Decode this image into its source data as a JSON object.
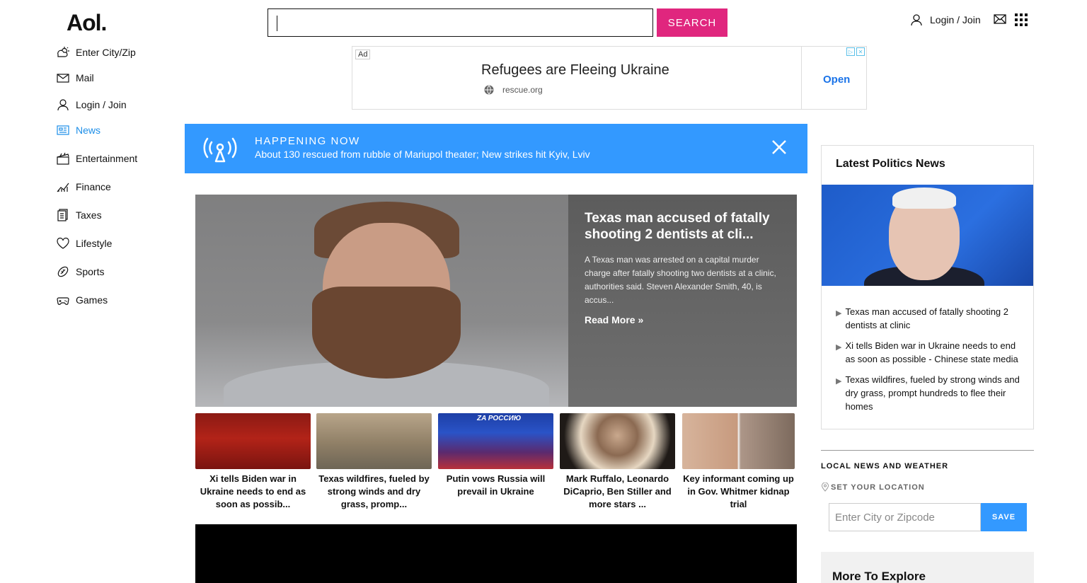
{
  "header": {
    "logo": "Aol.",
    "search_value": "",
    "search_button": "SEARCH",
    "login": "Login / Join"
  },
  "sidebar": {
    "items": [
      {
        "label": "Enter City/Zip",
        "icon": "weather-icon"
      },
      {
        "label": "Mail",
        "icon": "mail-icon"
      },
      {
        "label": "Login / Join",
        "icon": "user-icon"
      },
      {
        "label": "News",
        "icon": "news-icon",
        "active": true
      },
      {
        "label": "Entertainment",
        "icon": "clapperboard-icon"
      },
      {
        "label": "Finance",
        "icon": "chart-icon"
      },
      {
        "label": "Taxes",
        "icon": "document-icon"
      },
      {
        "label": "Lifestyle",
        "icon": "heart-icon"
      },
      {
        "label": "Sports",
        "icon": "football-icon"
      },
      {
        "label": "Games",
        "icon": "gamepad-icon"
      }
    ]
  },
  "ad": {
    "badge": "Ad",
    "title": "Refugees are Fleeing Ukraine",
    "url": "rescue.org",
    "cta": "Open"
  },
  "happening": {
    "label": "HAPPENING NOW",
    "text": "About 130 rescued from rubble of Mariupol theater; New strikes hit Kyiv, Lviv"
  },
  "hero": {
    "title": "Texas man accused of fatally shooting 2 dentists at cli...",
    "description": "A Texas man was arrested on a capital murder charge after fatally shooting two dentists at a clinic, authorities said. Steven Alexander Smith, 40, is accus...",
    "read_more": "Read More »"
  },
  "thumbs": [
    {
      "caption": "Xi tells Biden war in Ukraine needs to end as soon as possib..."
    },
    {
      "caption": "Texas wildfires, fueled by strong winds and dry grass, promp..."
    },
    {
      "caption": "Putin vows Russia will prevail in Ukraine",
      "overlay": "ZA РОССИЮ"
    },
    {
      "caption": "Mark Ruffalo, Leonardo DiCaprio, Ben Stiller and more stars ..."
    },
    {
      "caption": "Key informant coming up in Gov. Whitmer kidnap trial"
    }
  ],
  "politics": {
    "title": "Latest Politics News",
    "items": [
      "Texas man accused of fatally shooting 2 dentists at clinic",
      "Xi tells Biden war in Ukraine needs to end as soon as possible - Chinese state media",
      "Texas wildfires, fueled by strong winds and dry grass, prompt hundreds to flee their homes"
    ]
  },
  "local": {
    "title": "LOCAL NEWS AND WEATHER",
    "set_location": "SET YOUR LOCATION",
    "placeholder": "Enter City or Zipcode",
    "save": "SAVE"
  },
  "explore": {
    "title": "More To Explore"
  },
  "colors": {
    "accent_pink": "#e0267e",
    "accent_blue": "#3399ff",
    "active_nav": "#1c8ee8"
  }
}
